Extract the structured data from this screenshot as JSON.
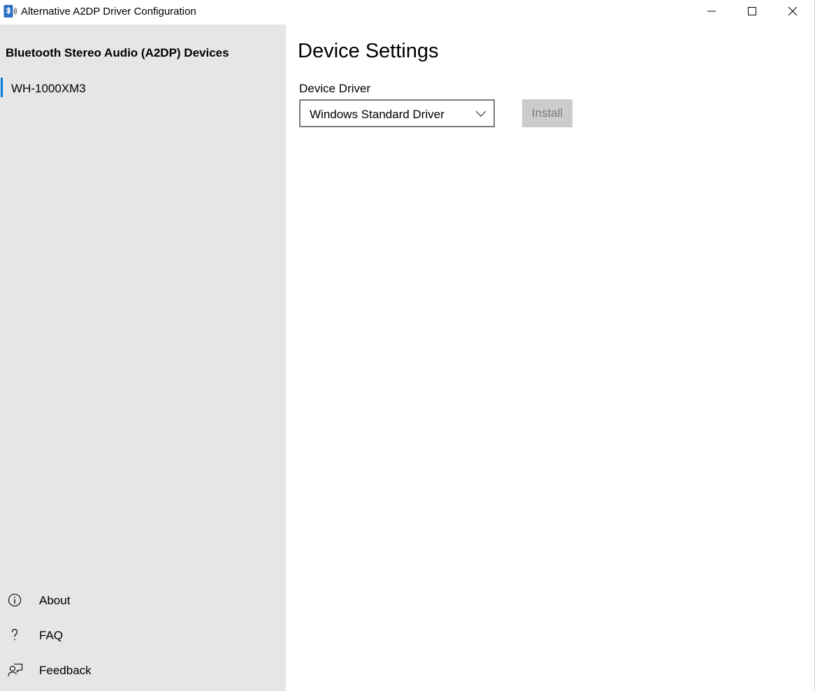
{
  "window": {
    "title": "Alternative A2DP Driver Configuration",
    "app_icon": "bluetooth-audio-icon",
    "controls": {
      "minimize_icon": "minimize-icon",
      "maximize_icon": "maximize-icon",
      "close_icon": "close-icon"
    }
  },
  "sidebar": {
    "heading": "Bluetooth Stereo Audio (A2DP) Devices",
    "devices": [
      {
        "label": "WH-1000XM3",
        "selected": true
      }
    ],
    "nav": [
      {
        "label": "About",
        "icon": "info-icon"
      },
      {
        "label": "FAQ",
        "icon": "question-icon"
      },
      {
        "label": "Feedback",
        "icon": "feedback-icon"
      }
    ]
  },
  "main": {
    "title": "Device Settings",
    "driver": {
      "label": "Device Driver",
      "selected": "Windows Standard Driver"
    },
    "install_label": "Install",
    "install_enabled": false
  },
  "colors": {
    "accent": "#0078d7",
    "sidebar_bg": "#e6e6e6",
    "disabled_button_bg": "#cccccc",
    "disabled_button_text": "#7a7a7a"
  }
}
